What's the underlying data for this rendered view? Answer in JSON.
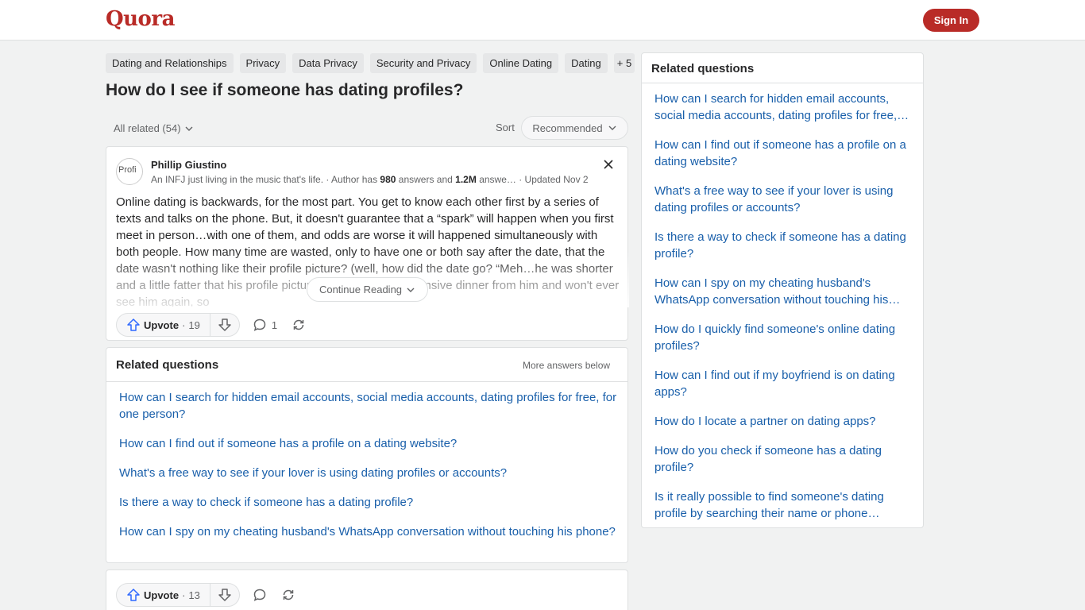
{
  "header": {
    "logo": "Quora",
    "sign_in": "Sign In"
  },
  "topics": [
    "Dating and Relationships",
    "Privacy",
    "Data Privacy",
    "Security and Privacy",
    "Online Dating",
    "Dating",
    "+ 5"
  ],
  "question": {
    "title": "How do I see if someone has dating profiles?"
  },
  "filters": {
    "all_related": "All related (54)",
    "sort_label": "Sort",
    "sort_value": "Recommended"
  },
  "answer": {
    "avatar_alt": "Profi",
    "author": "Phillip Giustino",
    "credential_prefix": "An INFJ just living in the music that's life. · Author has ",
    "answers_count": "980",
    "credential_mid": " answers and ",
    "views": "1.2M",
    "credential_suffix": " answe… · Updated Nov 2",
    "text": "Online dating is backwards, for the most part. You get to know each other first by a series of texts and talks on the phone. But, it doesn't guarantee that a “spark” will happen when you first meet in person…with one of them, and odds are worse it will happened simultaneously with both people. How many time are wasted, only to have one or both say after the date, that the date wasn't nothing like their profile picture? (well, how did the date go? “Meh…he was shorter and a little fatter that his profile picture” or I got a free expensive dinner from him and won't ever see him again, so",
    "continue": "Continue Reading",
    "upvote_label": "Upvote",
    "upvote_count": "19",
    "comment_count": "1"
  },
  "related_inline": {
    "title": "Related questions",
    "more": "More answers below",
    "items": [
      "How can I search for hidden email accounts, social media accounts, dating profiles for free, for one person?",
      "How can I find out if someone has a profile on a dating website?",
      "What's a free way to see if your lover is using dating profiles or accounts?",
      "Is there a way to check if someone has a dating profile?",
      "How can I spy on my cheating husband's WhatsApp conversation without touching his phone?"
    ]
  },
  "answer2": {
    "upvote_label": "Upvote",
    "upvote_count": "13"
  },
  "sidebar": {
    "title": "Related questions",
    "items": [
      "How can I search for hidden email accounts, social media accounts, dating profiles for free,…",
      "How can I find out if someone has a profile on a dating website?",
      "What's a free way to see if your lover is using dating profiles or accounts?",
      "Is there a way to check if someone has a dating profile?",
      "How can I spy on my cheating husband's WhatsApp conversation without touching his…",
      "How do I quickly find someone's online dating profiles?",
      "How can I find out if my boyfriend is on dating apps?",
      "How do I locate a partner on dating apps?",
      "How do you check if someone has a dating profile?",
      "Is it really possible to find someone's dating profile by searching their name or phone…"
    ]
  },
  "colors": {
    "brand": "#b92b27",
    "link": "#195faa",
    "background": "#f1f2f2"
  }
}
